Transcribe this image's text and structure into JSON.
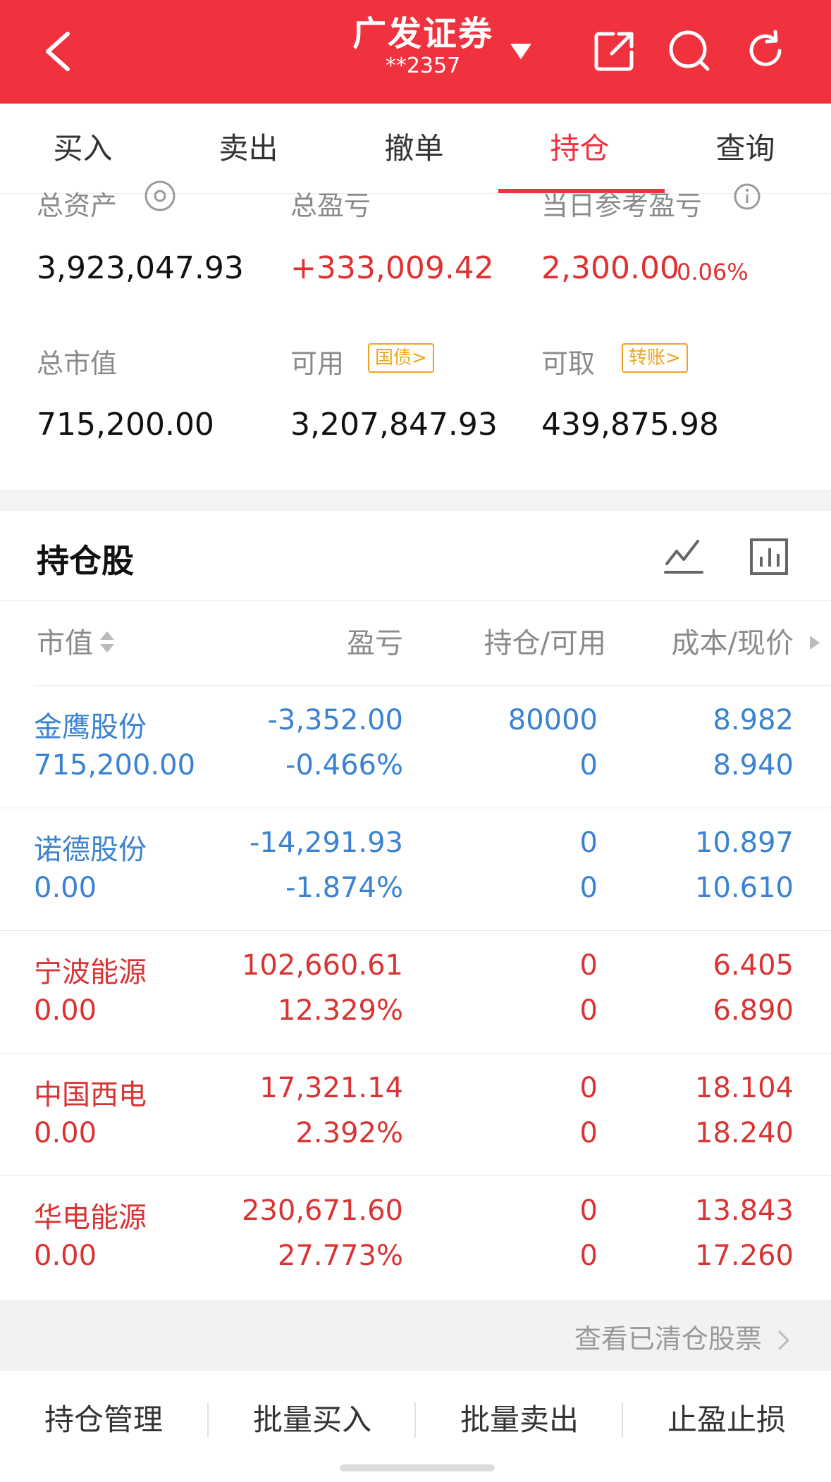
{
  "header": {
    "title": "广发证券",
    "account": "**2357",
    "bg_color": "#f0323f"
  },
  "tabs": [
    {
      "label": "买入"
    },
    {
      "label": "卖出"
    },
    {
      "label": "撤单"
    },
    {
      "label": "持仓",
      "active": true
    },
    {
      "label": "查询"
    }
  ],
  "summary": {
    "total_assets_label": "总资产",
    "total_assets": "3,923,047.93",
    "total_pnl_label": "总盈亏",
    "total_pnl": "+333,009.42",
    "today_pnl_label": "当日参考盈亏",
    "today_pnl": "2,300.00",
    "today_pnl_pct": "0.06%",
    "market_value_label": "总市值",
    "market_value": "715,200.00",
    "available_label": "可用",
    "available_chip": "国债>",
    "available": "3,207,847.93",
    "withdrawable_label": "可取",
    "withdrawable_chip": "转账>",
    "withdrawable": "439,875.98"
  },
  "holdings": {
    "title": "持仓股",
    "columns": {
      "value": "市值",
      "pnl": "盈亏",
      "position": "持仓/可用",
      "cost_price": "成本/现价"
    },
    "rows": [
      {
        "name": "金鹰股份",
        "value": "715,200.00",
        "pnl": "-3,352.00",
        "pnl_pct": "-0.466%",
        "position": "80000",
        "available": "0",
        "cost": "8.982",
        "price": "8.940",
        "trend": "down"
      },
      {
        "name": "诺德股份",
        "value": "0.00",
        "pnl": "-14,291.93",
        "pnl_pct": "-1.874%",
        "position": "0",
        "available": "0",
        "cost": "10.897",
        "price": "10.610",
        "trend": "down"
      },
      {
        "name": "宁波能源",
        "value": "0.00",
        "pnl": "102,660.61",
        "pnl_pct": "12.329%",
        "position": "0",
        "available": "0",
        "cost": "6.405",
        "price": "6.890",
        "trend": "up"
      },
      {
        "name": "中国西电",
        "value": "0.00",
        "pnl": "17,321.14",
        "pnl_pct": "2.392%",
        "position": "0",
        "available": "0",
        "cost": "18.104",
        "price": "18.240",
        "trend": "up"
      },
      {
        "name": "华电能源",
        "value": "0.00",
        "pnl": "230,671.60",
        "pnl_pct": "27.773%",
        "position": "0",
        "available": "0",
        "cost": "13.843",
        "price": "17.260",
        "trend": "up"
      }
    ],
    "cleared_link": "查看已清仓股票"
  },
  "bottom_bar": [
    {
      "label": "持仓管理"
    },
    {
      "label": "批量买入"
    },
    {
      "label": "批量卖出"
    },
    {
      "label": "止盈止损"
    }
  ],
  "colors": {
    "up": "#d93434",
    "down": "#3b82d1",
    "chip": "#f0a21e"
  }
}
